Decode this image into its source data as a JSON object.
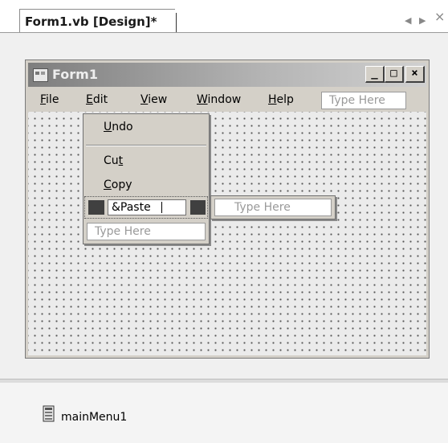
{
  "document_tab": {
    "label": "Form1.vb [Design]*",
    "nav_left": "◀",
    "nav_right": "▶",
    "close": "×"
  },
  "form": {
    "title": "Form1",
    "minimize": "_",
    "maximize": "□",
    "close": "×"
  },
  "menubar": {
    "items": [
      {
        "label": "File",
        "mnemonic": "F",
        "rest": "ile"
      },
      {
        "label": "Edit",
        "mnemonic": "E",
        "rest": "dit"
      },
      {
        "label": "View",
        "mnemonic": "V",
        "rest": "iew"
      },
      {
        "label": "Window",
        "mnemonic": "W",
        "rest": "indow"
      },
      {
        "label": "Help",
        "mnemonic": "H",
        "rest": "elp"
      }
    ],
    "type_here": "Type Here"
  },
  "edit_menu": {
    "undo": {
      "mnemonic": "U",
      "rest": "ndo"
    },
    "cut": {
      "pre": "Cu",
      "mnemonic": "t"
    },
    "copy": {
      "mnemonic": "C",
      "rest": "opy"
    },
    "paste_edit_value": "&Paste",
    "type_here": "Type Here",
    "submenu_type_here": "Type Here"
  },
  "component_tray": {
    "items": [
      {
        "label": "mainMenu1",
        "icon": "main-menu-component-icon"
      }
    ]
  }
}
